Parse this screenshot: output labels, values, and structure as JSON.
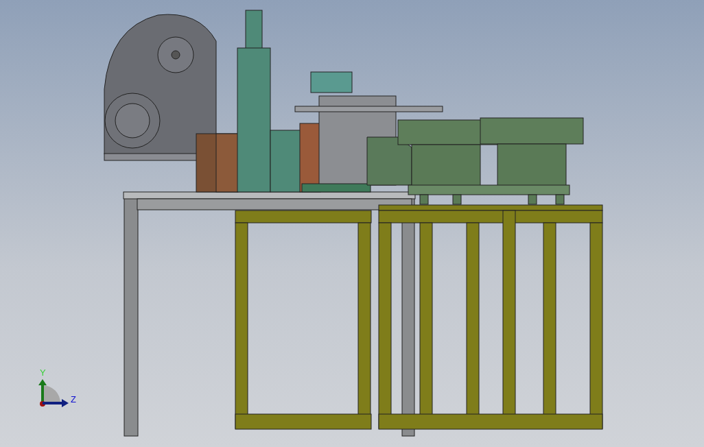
{
  "viewport": {
    "triad": {
      "axes": [
        {
          "kind": "vertical",
          "label": "Y"
        },
        {
          "kind": "horizontal",
          "label": "Z"
        }
      ]
    }
  }
}
